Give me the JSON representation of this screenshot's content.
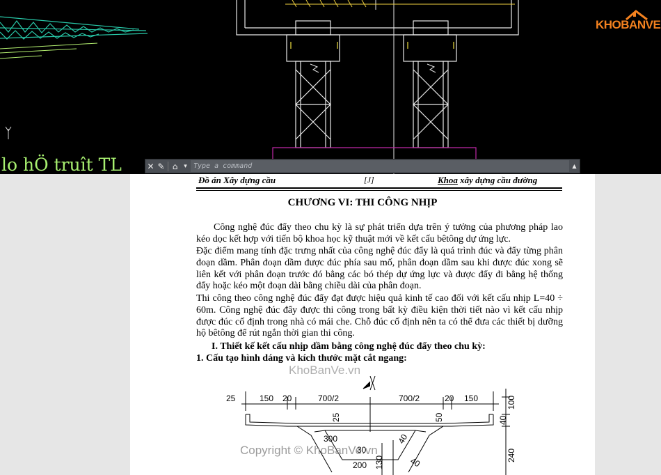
{
  "cad": {
    "overlay_text": "lo hÖ truît TL",
    "command": {
      "placeholder": "Type a command"
    }
  },
  "logo": {
    "text": "KHOBANVE"
  },
  "document": {
    "header": {
      "left": "Đồ án Xây dựng cầu",
      "middle": "[J]",
      "right_underlined": "Khoa",
      "right_rest": " xây dựng cầu  đường"
    },
    "chapter_title": "CHƯƠNG VI: THI CÔNG NHỊP",
    "paragraphs": [
      "Công nghệ đúc đẩy theo chu kỳ là sự phát triển dựa trên ý tưởng của phương pháp lao kéo dọc kết hợp với tiến bộ khoa học kỹ thuật mới về kết cấu bêtông dự ứng lực.",
      "Đặc điểm mang tính đặc trưng nhất của công nghệ đúc đẩy là quá trình đúc và đẩy từng phân đoạn dầm. Phân đoạn dầm được đúc phía sau mố, phân đoạn dầm sau khi được đúc xong sẽ liên kết với phân đoạn trước đó bằng các bó thép dự ứng lực và được đẩy đi bằng hệ thống đẩy hoặc kéo một đoạn dài bằng chiều dài của phân đoạn.",
      "Thi công theo công nghệ đúc đẩy đạt được hiệu quả kinh tế cao đối với kết cấu nhịp L=40 ÷ 60m. Công nghệ đúc đẩy được thi công trong bất kỳ điều kiện thời tiết nào vì kết cấu nhịp được đúc cố định trong nhà có mái che. Chỗ đúc cố định nên ta có thể đưa các thiết bị dưỡng hộ bêtông để rút ngắn thời gian thi công."
    ],
    "section_1": "I. Thiết kế kết cấu nhịp dầm bằng công nghệ đúc đẩy theo chu kỳ:",
    "subsection_1": "1. Cấu tạo hình dáng và kích thước mặt cắt ngang:",
    "drawing_dims": {
      "top": [
        "25",
        "150",
        "20",
        "700/2",
        "700/2",
        "20",
        "150"
      ],
      "right_top": "100",
      "right_mid": "40",
      "right_bottom": "240",
      "deck_left": "25",
      "deck_right": "50",
      "inner_top": "300",
      "inner_mid": "30",
      "inner_bottom": "200",
      "inner_vert": "130",
      "web_diag_1": "40",
      "web_diag_2": "40"
    },
    "watermark_top": "KhoBanVe.vn",
    "watermark_bottom": "Copyright © KhoBanVe.vn"
  }
}
